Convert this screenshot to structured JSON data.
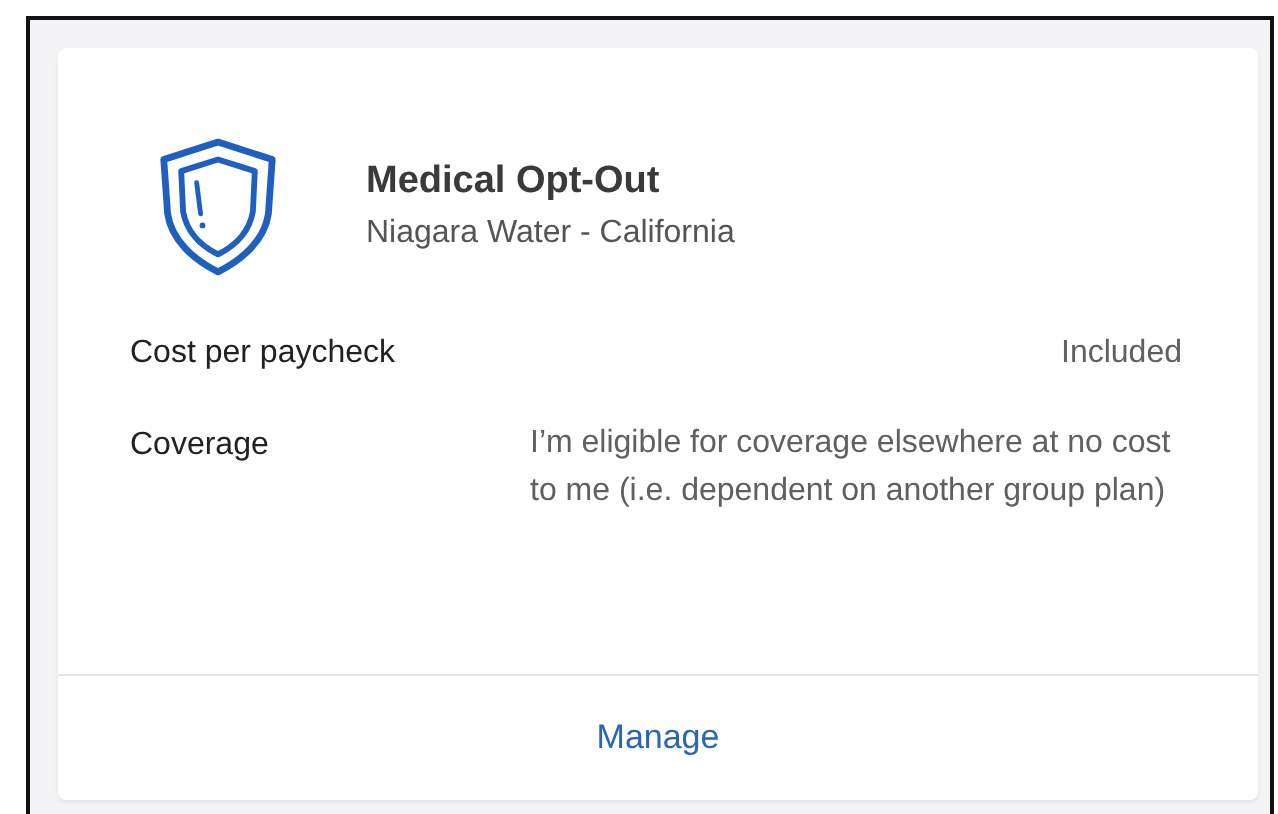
{
  "card": {
    "title": "Medical Opt-Out",
    "subtitle": "Niagara Water - California",
    "details": [
      {
        "label": "Cost per paycheck",
        "value": "Included",
        "kind": "inline"
      },
      {
        "label": "Coverage",
        "value": "I’m eligible for coverage elsewhere at no cost to me (i.e. dependent on another group plan)",
        "kind": "block"
      }
    ],
    "action": "Manage"
  }
}
